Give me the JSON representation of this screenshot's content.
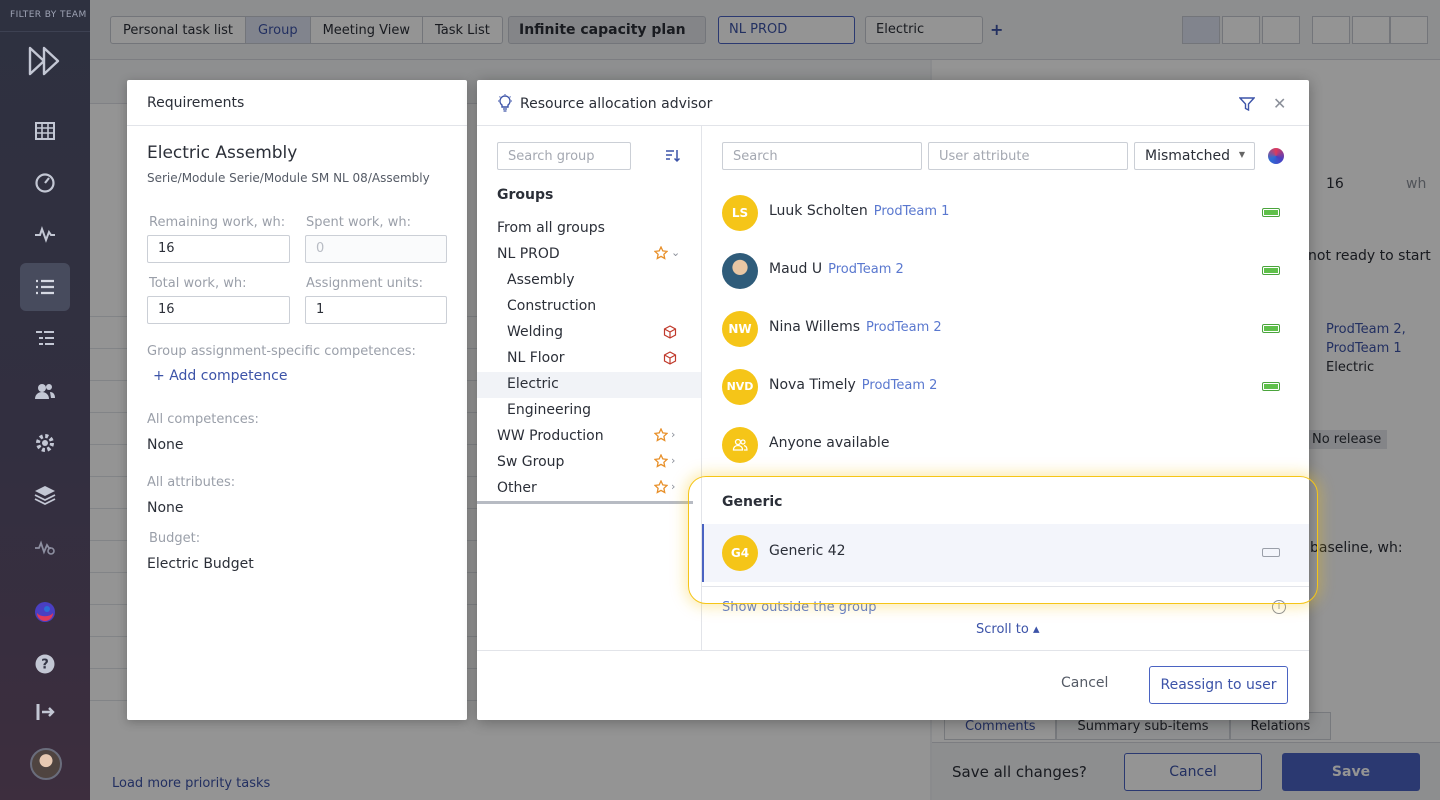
{
  "rail": {
    "title": "FILTER BY TEAM",
    "icons": [
      "logo-icon",
      "table-icon",
      "dashboard-icon",
      "pulse-icon",
      "list-icon",
      "hierarchy-icon",
      "users-icon",
      "settings-icon",
      "layers-icon",
      "analytics-icon",
      "ai-orb-icon",
      "help-icon",
      "logout-icon",
      "avatar"
    ]
  },
  "topbar": {
    "views": [
      "Personal task list",
      "Group",
      "Meeting View",
      "Task List"
    ],
    "active_view": "Group",
    "plan": "Infinite capacity plan",
    "org": "NL PROD",
    "group_value": "Electric",
    "add": "+"
  },
  "background": {
    "load_more": "Load more priority tasks",
    "side_values": [
      "16",
      "wh",
      "not ready to start",
      "ProdTeam 2,",
      "ProdTeam 1",
      "Electric",
      "No release",
      "baseline, wh:"
    ],
    "tabs": [
      "Comments",
      "Summary sub-items",
      "Relations"
    ],
    "save_prompt": "Save all changes?",
    "cancel": "Cancel",
    "save": "Save"
  },
  "requirements": {
    "header": "Requirements",
    "title": "Electric Assembly",
    "path": "Serie/Module Serie/Module SM NL 08/Assembly",
    "remaining_label": "Remaining work, wh:",
    "remaining_value": "16",
    "spent_label": "Spent work, wh:",
    "spent_value": "0",
    "total_label": "Total work, wh:",
    "total_value": "16",
    "units_label": "Assignment units:",
    "units_value": "1",
    "group_comp_label": "Group assignment-specific competences:",
    "add_competence": "Add competence",
    "all_comp_label": "All competences:",
    "all_comp_value": "None",
    "all_attr_label": "All attributes:",
    "all_attr_value": "None",
    "budget_label": "Budget:",
    "budget_value": "Electric Budget"
  },
  "advisor": {
    "title": "Resource allocation advisor",
    "group_search_placeholder": "Search group",
    "groups_heading": "Groups",
    "groups": [
      {
        "label": "From all groups"
      },
      {
        "label": "NL PROD"
      },
      {
        "label": "Assembly"
      },
      {
        "label": "Construction"
      },
      {
        "label": "Welding"
      },
      {
        "label": "NL Floor"
      },
      {
        "label": "Electric",
        "selected": true
      },
      {
        "label": "Engineering"
      },
      {
        "label": "WW Production"
      },
      {
        "label": "Sw Group"
      },
      {
        "label": "Other"
      }
    ],
    "search_placeholder": "Search",
    "attr_placeholder": "User attribute",
    "filter_value": "Mismatched",
    "users": [
      {
        "initials": "LS",
        "name": "Luuk Scholten",
        "team": "ProdTeam 1",
        "capacity": "full"
      },
      {
        "initials": "",
        "name": "Maud U",
        "team": "ProdTeam 2",
        "capacity": "full"
      },
      {
        "initials": "NW",
        "name": "Nina Willems",
        "team": "ProdTeam 2",
        "capacity": "full"
      },
      {
        "initials": "NVD",
        "name": "Nova Timely",
        "team": "ProdTeam 2",
        "capacity": "full"
      },
      {
        "initials": "",
        "name": "Anyone available",
        "team": "",
        "capacity": "none"
      }
    ],
    "generic_heading": "Generic",
    "generic_user": {
      "initials": "G4",
      "name": "Generic 42",
      "capacity": "empty"
    },
    "show_outside": "Show outside the group",
    "scroll_to": "Scroll to ▴",
    "cancel": "Cancel",
    "reassign": "Reassign to user"
  }
}
